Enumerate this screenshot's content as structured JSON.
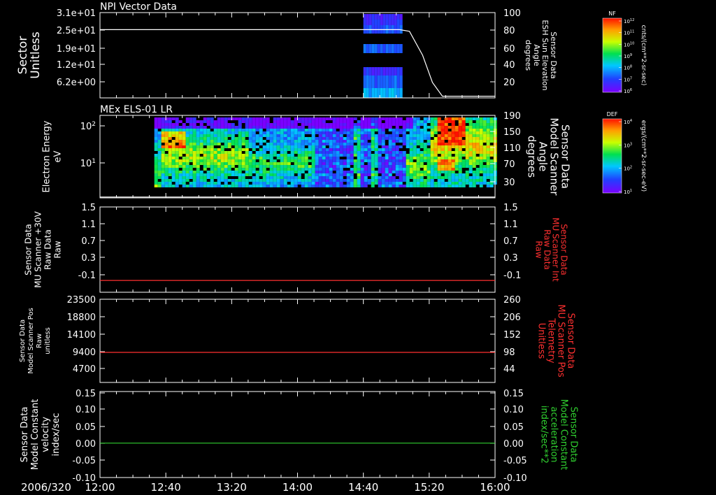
{
  "header": {
    "date": "2006/320"
  },
  "time_axis": {
    "labels": [
      "12:00",
      "12:40",
      "13:20",
      "14:00",
      "14:40",
      "15:20",
      "16:00"
    ],
    "start_min": 0,
    "end_min": 240,
    "major_every_min": 40,
    "minor_every_min": 10
  },
  "colorbars": [
    {
      "title": "NF",
      "unit": "cnts/(cm**2-sr-sec)",
      "tick_labels": [
        "10^12",
        "10^11",
        "10^10",
        "10^9",
        "10^8",
        "10^7",
        "10^6"
      ]
    },
    {
      "title": "DEF",
      "unit": "ergs/(cm**2-sr-sec-eV)",
      "tick_labels": [
        "10^4",
        "10^3",
        "10^2",
        "10^1"
      ]
    }
  ],
  "chart_data": [
    {
      "type": "heatmap",
      "title": "NPI Vector Data",
      "left_label": [
        "Sector",
        "Unitless"
      ],
      "right_label": [
        "Sensor Data",
        "ESH Sun Elevation",
        "Angle",
        "degrees"
      ],
      "left_ticks": [
        "3.1e+01",
        "2.5e+01",
        "1.9e+01",
        "1.2e+01",
        "6.2e+00"
      ],
      "right_ticks": [
        "100",
        "80",
        "60",
        "40",
        "20"
      ],
      "right_range": [
        0,
        100
      ],
      "heatmap_time_range_min": [
        160,
        183
      ],
      "line": {
        "color": "#ffffff",
        "points": [
          [
            0,
            80
          ],
          [
            165,
            80
          ],
          [
            182,
            80
          ],
          [
            188,
            78
          ],
          [
            196,
            50
          ],
          [
            202,
            18
          ],
          [
            208,
            2
          ],
          [
            240,
            2
          ]
        ]
      }
    },
    {
      "type": "heatmap",
      "title": "MEx ELS-01 LR",
      "left_label": [
        "Electron Energy",
        "eV"
      ],
      "right_label": [
        "Sensor Data",
        "Model Scanner",
        "Angle",
        "degrees"
      ],
      "left_ticks": [
        "10^2",
        "10^1"
      ],
      "right_ticks": [
        "190",
        "150",
        "110",
        "70",
        "30"
      ],
      "right_range": [
        0,
        190
      ],
      "heatmap_time_range_min": [
        33,
        240
      ],
      "line": {
        "color": "#ffffff",
        "points": [
          [
            0,
            2
          ],
          [
            240,
            2
          ]
        ]
      }
    },
    {
      "type": "line",
      "left_label": [
        "Sensor Data",
        "MU Scanner +30V",
        "Raw Data",
        "Raw"
      ],
      "right_label": [
        "Sensor Data",
        "MU Scanner Int",
        "Raw Data",
        "Raw"
      ],
      "left_ticks": [
        "1.5",
        "1.1",
        "0.7",
        "0.3",
        "-0.1"
      ],
      "right_ticks": [
        "1.5",
        "1.1",
        "0.7",
        "0.3",
        "-0.1"
      ],
      "left_range": [
        -0.3,
        1.5
      ],
      "line": {
        "color": "#ff3030",
        "points": [
          [
            0,
            -0.05
          ],
          [
            240,
            -0.05
          ]
        ]
      }
    },
    {
      "type": "line",
      "left_label": [
        "Sensor Data",
        "Model Scanner Pos",
        "Raw",
        "unitless"
      ],
      "right_label": [
        "Sensor Data",
        "MU Scanner Pos",
        "Telemetry",
        "Unitless"
      ],
      "left_ticks": [
        "23500",
        "18800",
        "14100",
        "9400",
        "4700"
      ],
      "right_ticks": [
        "260",
        "206",
        "152",
        "98",
        "44"
      ],
      "left_range": [
        0,
        23500
      ],
      "line": {
        "color": "#ff3030",
        "points": [
          [
            0,
            8500
          ],
          [
            240,
            8500
          ]
        ]
      }
    },
    {
      "type": "line",
      "left_label": [
        "Sensor Data",
        "Model Constant",
        "velocity",
        "index/sec"
      ],
      "right_label": [
        "Sensor Data",
        "Model Constant",
        "acceleration",
        "index/sec**2"
      ],
      "left_ticks": [
        "0.15",
        "0.10",
        "0.05",
        "0.00",
        "-0.05",
        "-0.10"
      ],
      "right_ticks": [
        "0.15",
        "0.10",
        "0.05",
        "0.00",
        "-0.05",
        "-0.10"
      ],
      "left_range": [
        -0.1,
        0.15
      ],
      "line": {
        "color": "#30d030",
        "points": [
          [
            0,
            0
          ],
          [
            240,
            0
          ]
        ]
      }
    }
  ]
}
